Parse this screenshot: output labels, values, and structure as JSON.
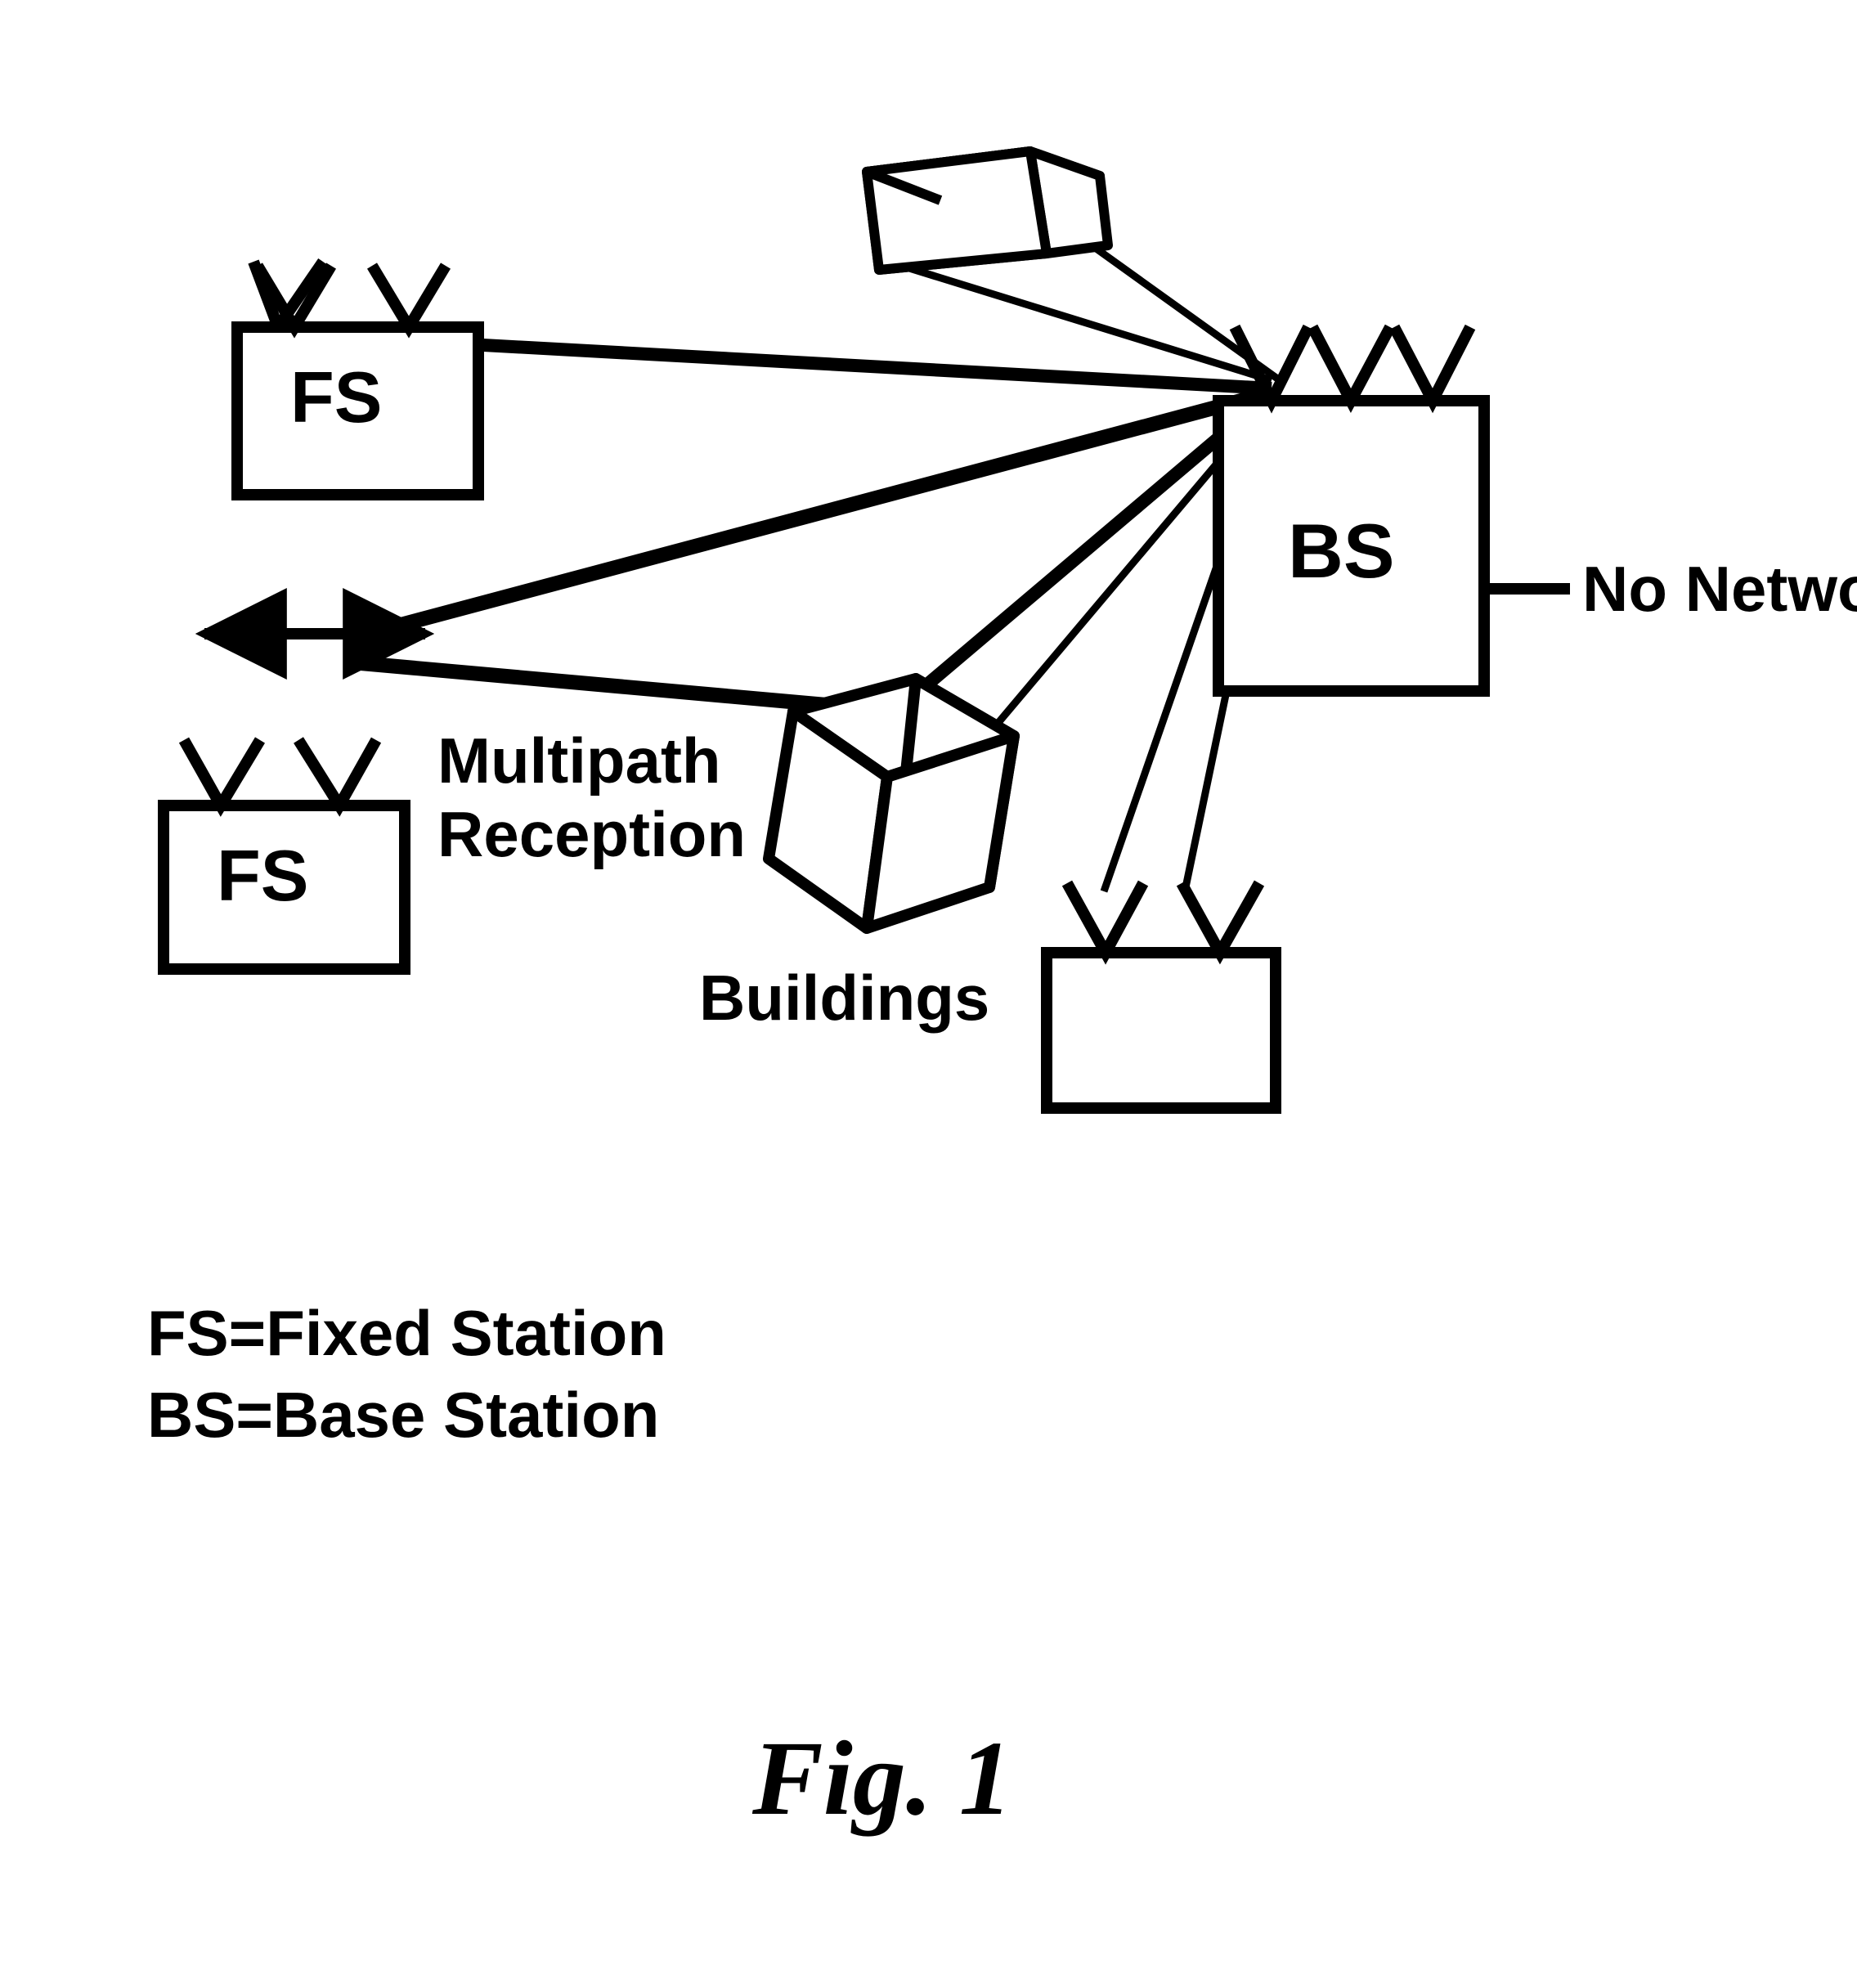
{
  "labels": {
    "fs1": "FS",
    "fs2": "FS",
    "bs": "BS",
    "no_network": "No Network",
    "multipath1": "Multipath",
    "multipath2": "Reception",
    "buildings": "Buildings",
    "legend_fs": "FS=Fixed Station",
    "legend_bs": "BS=Base Station",
    "figcaption": "Fig. 1"
  }
}
